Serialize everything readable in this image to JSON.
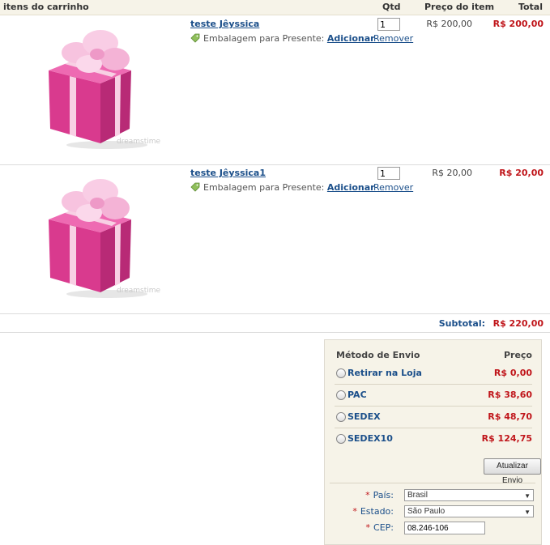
{
  "header": {
    "items_label": "itens do carrinho",
    "qty_label": "Qtd",
    "price_label": "Preço do item",
    "total_label": "Total"
  },
  "items": [
    {
      "name": "teste Jêyssica",
      "wrap_text": "Embalagem para Presente:",
      "wrap_link": "Adicionar",
      "qty": "1",
      "remove": "Remover",
      "price": "R$ 200,00",
      "total": "R$ 200,00"
    },
    {
      "name": "teste Jêyssica1",
      "wrap_text": "Embalagem para Presente:",
      "wrap_link": "Adicionar",
      "qty": "1",
      "remove": "Remover",
      "price": "R$ 20,00",
      "total": "R$ 20,00"
    }
  ],
  "subtotal": {
    "label": "Subtotal:",
    "value": "R$ 220,00"
  },
  "shipping": {
    "method_header": "Método de Envio",
    "price_header": "Preço",
    "options": [
      {
        "name": "Retirar na Loja",
        "price": "R$ 0,00"
      },
      {
        "name": "PAC",
        "price": "R$ 38,60"
      },
      {
        "name": "SEDEX",
        "price": "R$ 48,70"
      },
      {
        "name": "SEDEX10",
        "price": "R$ 124,75"
      }
    ],
    "update_button": "Atualizar Envio",
    "country_label": "País:",
    "country_value": "Brasil",
    "state_label": "Estado:",
    "state_value": "São Paulo",
    "cep_label": "CEP:",
    "cep_value": "08.246-106",
    "required_mark": "*"
  },
  "colors": {
    "accent": "#1b4f8a",
    "price": "#c0161b",
    "gift": "#e0489a",
    "ribbon": "#f4b8d8"
  }
}
